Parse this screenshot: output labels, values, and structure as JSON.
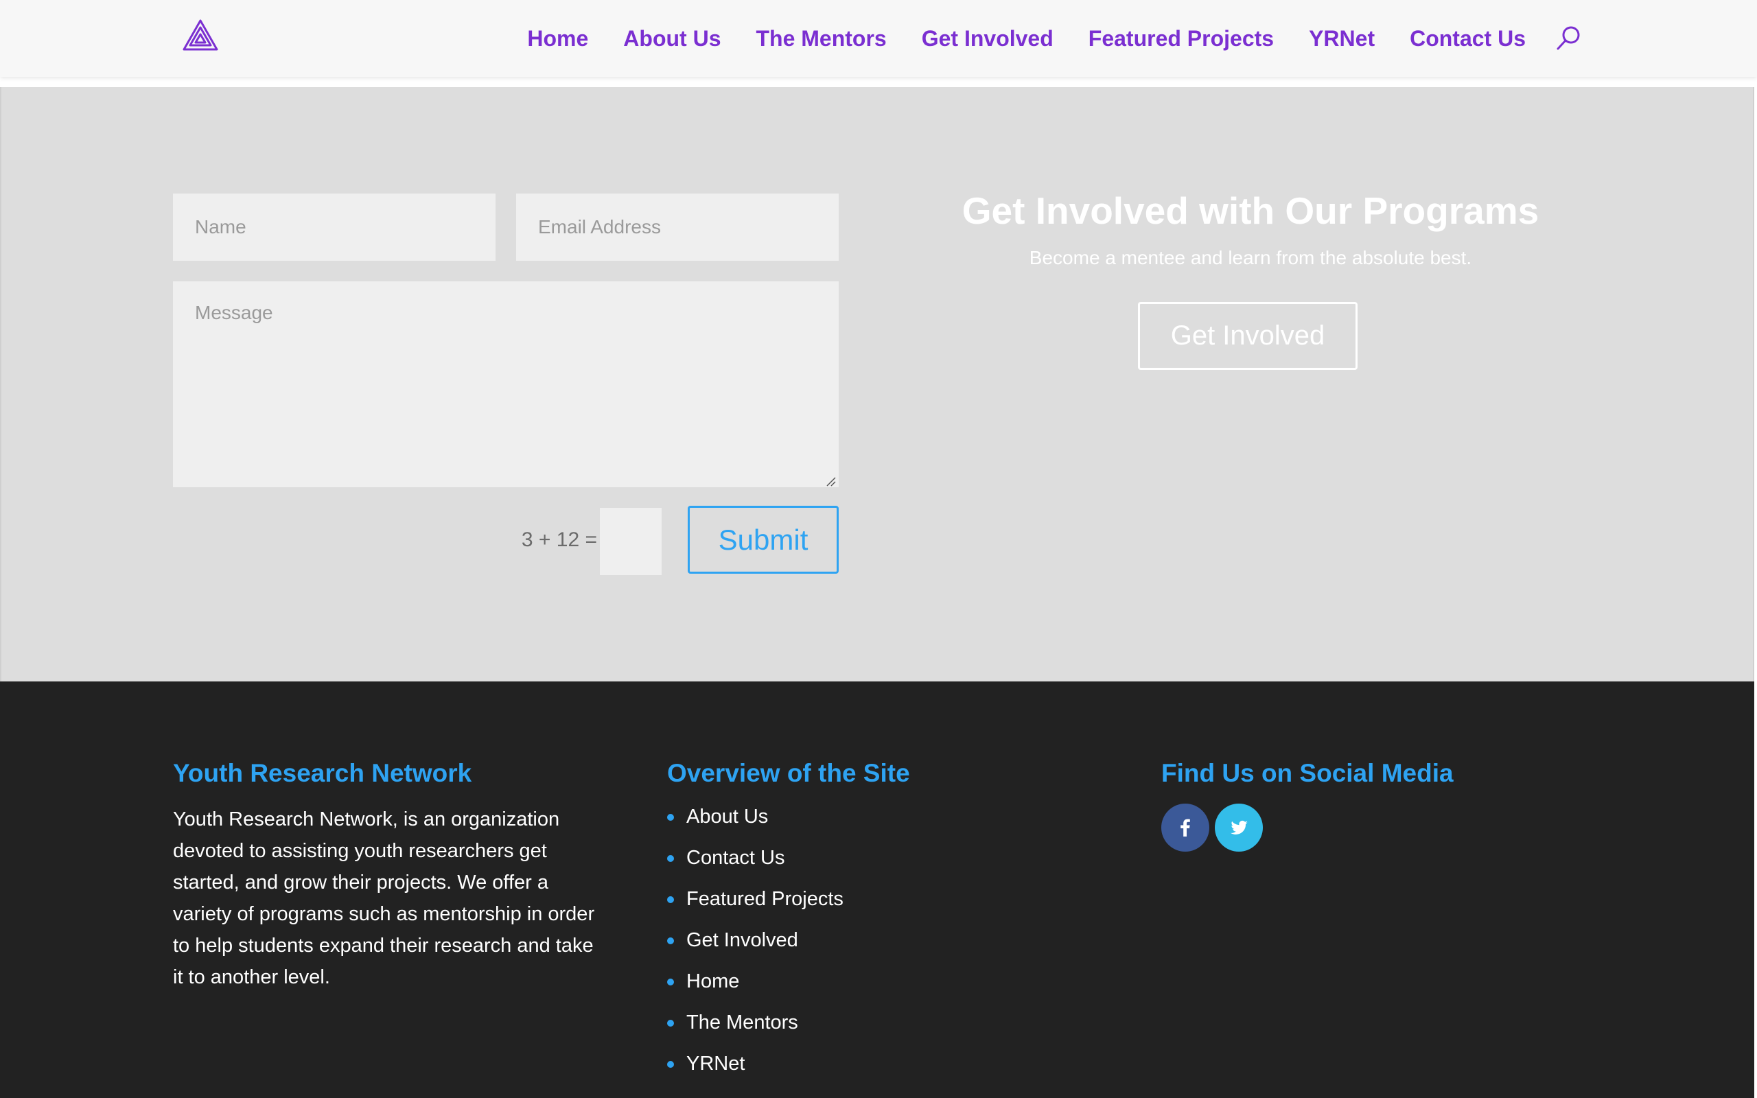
{
  "header": {
    "logo_icon": "spiral-triangle-logo",
    "nav": [
      "Home",
      "About Us",
      "The Mentors",
      "Get Involved",
      "Featured Projects",
      "YRNet",
      "Contact Us"
    ],
    "search_icon": "search-icon"
  },
  "contact_form": {
    "name_placeholder": "Name",
    "email_placeholder": "Email Address",
    "message_placeholder": "Message",
    "captcha_label": "3 + 12 =",
    "submit_label": "Submit"
  },
  "cta": {
    "title": "Get Involved with Our Programs",
    "subtitle": "Become a mentee and learn from the absolute best.",
    "button_label": "Get Involved"
  },
  "footer": {
    "about_heading": "Youth Research Network",
    "about_text": "Youth Research Network, is an organization devoted to assisting youth researchers get started, and grow their projects. We offer a variety of programs such as mentorship in order to help students expand their research and take it to another level.",
    "overview_heading": "Overview of the Site",
    "overview_links": [
      "About Us",
      "Contact Us",
      "Featured Projects",
      "Get Involved",
      "Home",
      "The Mentors",
      "YRNet"
    ],
    "social_heading": "Find Us on Social Media",
    "social": [
      {
        "icon": "facebook-icon",
        "glyph": "f",
        "color": "#3b5998"
      },
      {
        "icon": "twitter-icon",
        "glyph": "t",
        "color": "#00aced"
      }
    ]
  },
  "colors": {
    "nav": "#7b2fd1",
    "accent": "#2ea3f2",
    "band": "#dddddd",
    "footer": "#222222"
  }
}
